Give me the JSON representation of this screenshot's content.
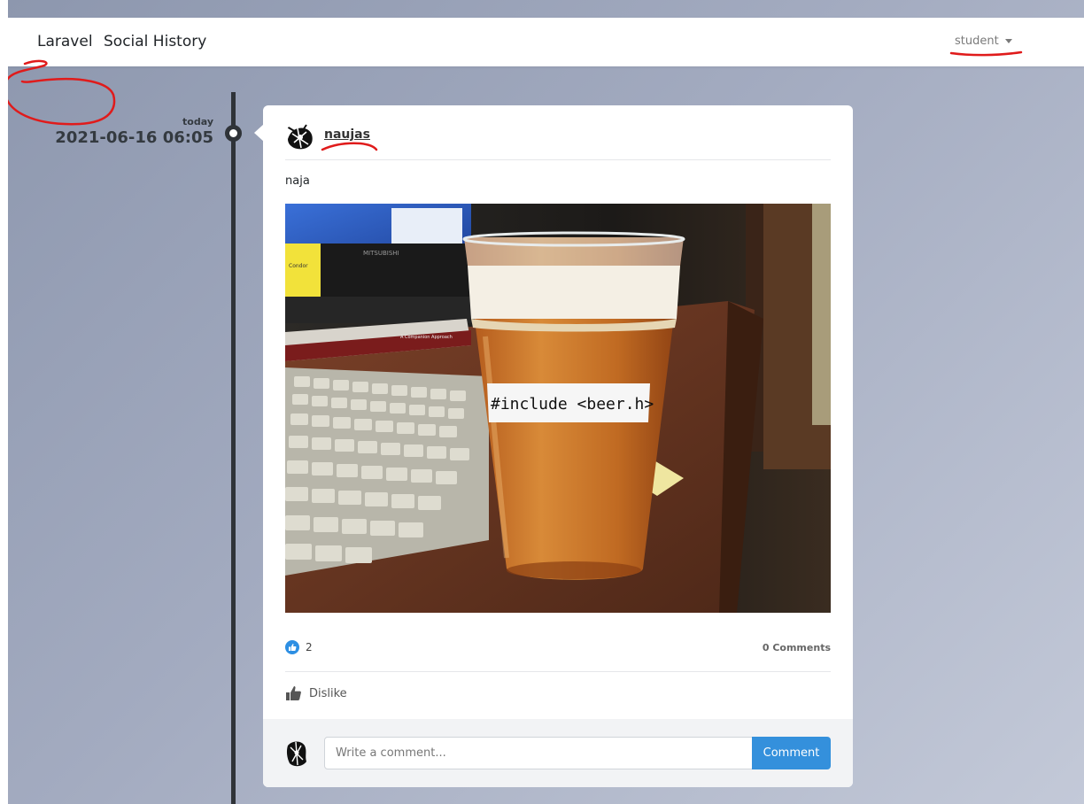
{
  "navbar": {
    "brand": "Laravel",
    "link": "Social History",
    "user": "student"
  },
  "timeline": {
    "relative": "today",
    "date": "2021-06-16 06:05"
  },
  "post": {
    "author": "naujas",
    "text": "naja",
    "image": {
      "label": "#include <beer.h>",
      "monitor_brand": "MITSUBISHI",
      "sticky_note": "Condor",
      "book_title": "A Companion Approach"
    },
    "likes": "2",
    "comments": "0 Comments",
    "action": "Dislike"
  },
  "comment": {
    "placeholder": "Write a comment...",
    "button": "Comment"
  },
  "colors": {
    "primary": "#3490dc",
    "timeline": "#2f3338",
    "annotation": "#e01b1b"
  }
}
